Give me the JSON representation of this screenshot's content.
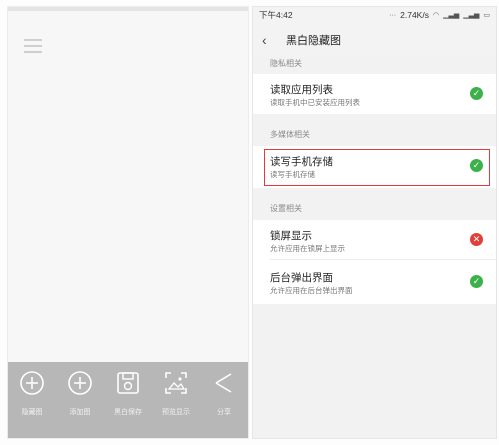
{
  "left_toolbar": {
    "items": [
      {
        "icon": "plus-circle-icon",
        "label": "隐藏图"
      },
      {
        "icon": "plus-circle-icon",
        "label": "添加图"
      },
      {
        "icon": "save-icon",
        "label": "黑白保存"
      },
      {
        "icon": "image-frame-icon",
        "label": "预览显示"
      },
      {
        "icon": "share-icon",
        "label": "分享"
      }
    ]
  },
  "statusbar": {
    "time": "下午4:42",
    "speed": "2.74K/s"
  },
  "header": {
    "title": "黑白隐藏图"
  },
  "sections": [
    {
      "label": "隐私相关"
    },
    {
      "label": "多媒体相关"
    },
    {
      "label": "设置相关"
    }
  ],
  "items": [
    {
      "title": "读取应用列表",
      "subtitle": "读取手机中已安装应用列表",
      "status": "allowed"
    },
    {
      "title": "读写手机存储",
      "subtitle": "读写手机存储",
      "status": "allowed"
    },
    {
      "title": "锁屏显示",
      "subtitle": "允许应用在锁屏上显示",
      "status": "denied"
    },
    {
      "title": "后台弹出界面",
      "subtitle": "允许应用在后台弹出界面",
      "status": "allowed"
    }
  ],
  "colors": {
    "allowed": "#3bb14a",
    "denied": "#e0403a",
    "highlight": "#e23b3b",
    "toolbar": "#b7b7b7"
  }
}
